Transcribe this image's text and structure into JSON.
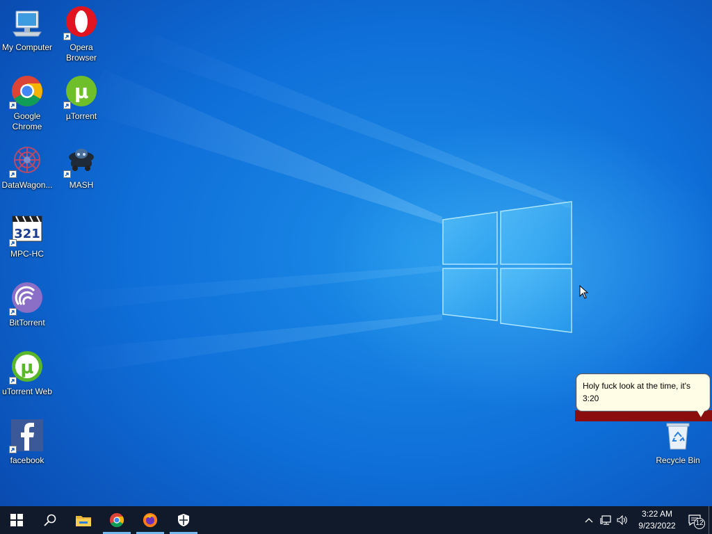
{
  "desktop": {
    "icons": [
      {
        "label": "My Computer",
        "icon": "monitor-icon"
      },
      {
        "label": "Opera Browser",
        "icon": "opera-icon"
      },
      {
        "label": "Google Chrome",
        "icon": "chrome-icon"
      },
      {
        "label": "µTorrent",
        "icon": "utorrent-icon"
      },
      {
        "label": "DataWagon...",
        "icon": "datawagon-icon"
      },
      {
        "label": "MASH",
        "icon": "mash-icon"
      },
      {
        "label": "MPC-HC",
        "icon": "mpc-hc-icon"
      },
      {
        "label": "BitTorrent",
        "icon": "bittorrent-icon"
      },
      {
        "label": "uTorrent Web",
        "icon": "utorrent-web-icon"
      },
      {
        "label": "facebook",
        "icon": "facebook-icon"
      },
      {
        "label": "Recycle Bin",
        "icon": "recycle-bin-icon"
      }
    ],
    "bubble_text": "Holy fuck look at the time, it's 3:20"
  },
  "taskbar": {
    "pinned": [
      "start-icon",
      "search-icon",
      "file-explorer-icon",
      "chrome-icon",
      "firefox-icon",
      "security-shield-icon"
    ],
    "tray_icons": [
      "chevron-up-icon",
      "network-icon",
      "volume-icon"
    ],
    "clock_time": "3:22 AM",
    "clock_date": "9/23/2022",
    "notification_count": "12"
  },
  "colors": {
    "desktop_blue": "#0f6fd9",
    "taskbar": "#101a2a",
    "bubble_bar": "#8b0d0d",
    "active_indicator": "#76b9ed"
  }
}
